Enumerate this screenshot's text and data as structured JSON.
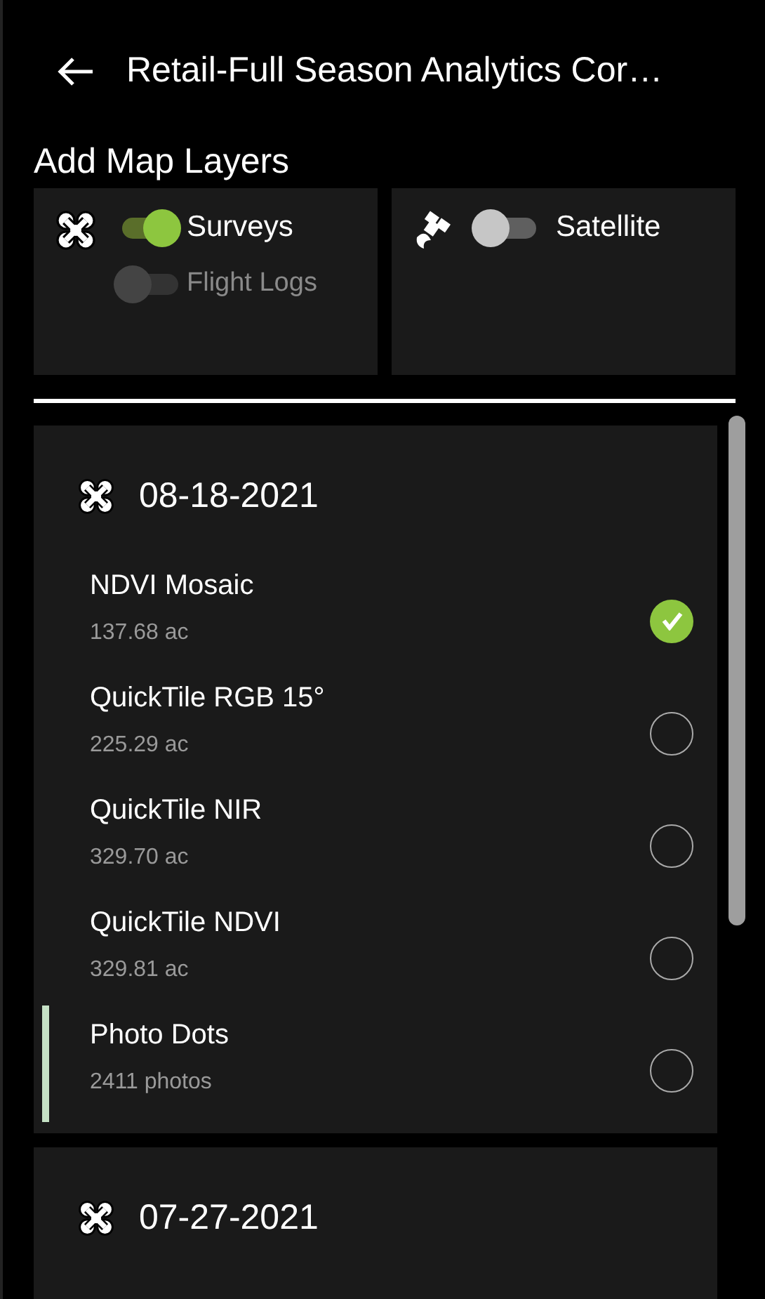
{
  "header": {
    "title": "Retail-Full Season Analytics Cor…"
  },
  "heading": "Add Map Layers",
  "layer_cards": [
    {
      "kind": "drone",
      "toggles": [
        {
          "label": "Surveys",
          "on": true,
          "disabled": false
        },
        {
          "label": "Flight Logs",
          "on": false,
          "disabled": true
        }
      ]
    },
    {
      "kind": "satellite",
      "toggles": [
        {
          "label": "Satellite",
          "on": false,
          "disabled": false
        }
      ]
    }
  ],
  "surveys": [
    {
      "date": "08-18-2021",
      "items": [
        {
          "name": "NDVI Mosaic",
          "detail": "137.68 ac",
          "selected": true,
          "highlighted": false
        },
        {
          "name": "QuickTile RGB 15°",
          "detail": "225.29 ac",
          "selected": false,
          "highlighted": false
        },
        {
          "name": "QuickTile NIR",
          "detail": "329.70 ac",
          "selected": false,
          "highlighted": false
        },
        {
          "name": "QuickTile NDVI",
          "detail": "329.81 ac",
          "selected": false,
          "highlighted": false
        },
        {
          "name": "Photo Dots",
          "detail": "2411 photos",
          "selected": false,
          "highlighted": true
        }
      ]
    },
    {
      "date": "07-27-2021"
    }
  ]
}
